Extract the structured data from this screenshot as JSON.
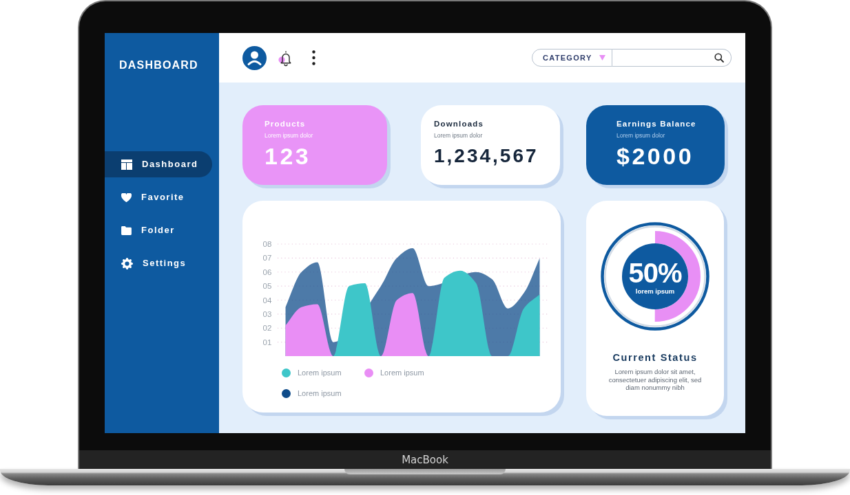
{
  "device": {
    "label": "MacBook"
  },
  "sidebar": {
    "title": "DASHBOARD",
    "items": [
      {
        "label": "Dashboard",
        "selected": true
      },
      {
        "label": "Favorite",
        "selected": false
      },
      {
        "label": "Folder",
        "selected": false
      },
      {
        "label": "Settings",
        "selected": false
      }
    ]
  },
  "top_bar": {
    "category": "CATEGORY"
  },
  "stats": [
    {
      "title": "Products",
      "subtitle": "Lorem ipsum dolor",
      "value": "123",
      "color": "#e994f7"
    },
    {
      "title": "Downloads",
      "subtitle": "Lorem ipsum dolor",
      "value": "1,234,567",
      "color": "#ffffff"
    },
    {
      "title": "Earnings Balance",
      "subtitle": "Lorem ipsum dolor",
      "value": "$2000",
      "color": "#0e5aa0"
    }
  ],
  "activity_chart": {
    "chart_data": {
      "type": "area",
      "grid": true,
      "series": [
        {
          "name": "Lorem ipsum",
          "color": "#3ec6c9",
          "values": [
            0,
            0,
            0,
            0,
            5.0,
            5.2,
            0,
            0,
            0,
            0,
            5.6,
            6.1,
            5.2,
            0,
            0,
            3.4,
            4.4
          ]
        },
        {
          "name": "Lorem ipsum",
          "color": "#e98ef5",
          "values": [
            2.2,
            3.5,
            3.7,
            0,
            null,
            null,
            0,
            4.0,
            4.5,
            0,
            null,
            null,
            null,
            0,
            0,
            null,
            null
          ]
        },
        {
          "name": "Lorem ipsum",
          "color": "#0f4c8a",
          "values": [
            3.5,
            6.0,
            6.7,
            1.0,
            null,
            null,
            5.0,
            7.0,
            7.7,
            5.0,
            null,
            null,
            6.0,
            5.5,
            3.4,
            4.5,
            7.0
          ]
        }
      ],
      "ylim": [
        0,
        8
      ],
      "yticks": [
        {
          "value": 1,
          "label": "01"
        },
        {
          "value": 2,
          "label": "02"
        },
        {
          "value": 3,
          "label": "03"
        },
        {
          "value": 4,
          "label": "04"
        },
        {
          "value": 5,
          "label": "05"
        },
        {
          "value": 6,
          "label": "06"
        },
        {
          "value": 7,
          "label": "07"
        },
        {
          "value": 8,
          "label": "08"
        }
      ]
    }
  },
  "status": {
    "level": 0.5,
    "reading": "50%",
    "caption": "lorem ipsum",
    "title": "Current Status",
    "description": "Lorem ipsum dolor sit amet, consectetuer adipiscing elit, sed diam nonummy nibh"
  }
}
